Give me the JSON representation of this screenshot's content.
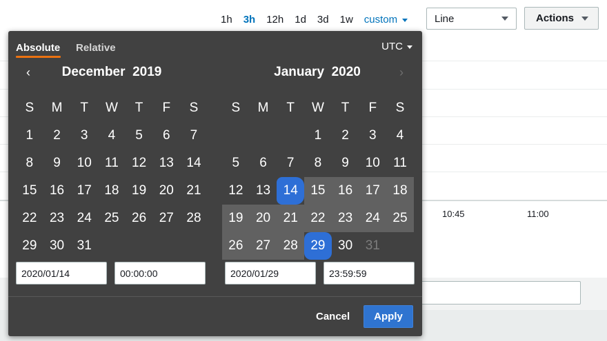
{
  "toolbar": {
    "range_options": [
      {
        "label": "1h",
        "active": false
      },
      {
        "label": "3h",
        "active": true
      },
      {
        "label": "12h",
        "active": false
      },
      {
        "label": "1d",
        "active": false
      },
      {
        "label": "3d",
        "active": false
      },
      {
        "label": "1w",
        "active": false
      }
    ],
    "custom_label": "custom",
    "chart_type_value": "Line",
    "actions_label": "Actions"
  },
  "chart_background": {
    "x_ticks": [
      "10:45",
      "11:00"
    ]
  },
  "date_picker": {
    "tabs": {
      "absolute": "Absolute",
      "relative": "Relative"
    },
    "timezone": "UTC",
    "nav_prev": "‹",
    "nav_next": "›",
    "weekdays": [
      "S",
      "M",
      "T",
      "W",
      "T",
      "F",
      "S"
    ],
    "left_month": {
      "month": "December",
      "year": "2019",
      "leading_blanks": 0,
      "days": 31
    },
    "right_month": {
      "month": "January",
      "year": "2020",
      "leading_blanks": 3,
      "days": 31,
      "range_start": 14,
      "range_end": 29,
      "disabled_from": 31
    },
    "start_date": "2020/01/14",
    "start_time": "00:00:00",
    "end_date": "2020/01/29",
    "end_time": "23:59:59",
    "cancel_label": "Cancel",
    "apply_label": "Apply"
  },
  "colors": {
    "accent_blue": "#0073bb",
    "selection_blue": "#2e6fd6",
    "tab_underline": "#ec7211",
    "popover_bg": "#414141",
    "range_bg": "#616161"
  }
}
